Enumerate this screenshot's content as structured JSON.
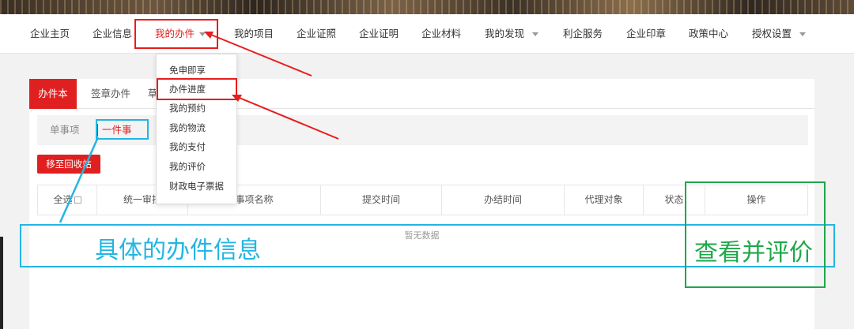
{
  "nav": {
    "items": [
      {
        "label": "企业主页"
      },
      {
        "label": "企业信息"
      },
      {
        "label": "我的办件"
      },
      {
        "label": "我的项目"
      },
      {
        "label": "企业证照"
      },
      {
        "label": "企业证明"
      },
      {
        "label": "企业材料"
      },
      {
        "label": "我的发现"
      },
      {
        "label": "利企服务"
      },
      {
        "label": "企业印章"
      },
      {
        "label": "政策中心"
      },
      {
        "label": "授权设置"
      }
    ]
  },
  "dropdown": {
    "items": [
      "免申即享",
      "办件进度",
      "我的预约",
      "我的物流",
      "我的支付",
      "我的评价",
      "财政电子票据"
    ]
  },
  "tabs": [
    "办件本",
    "签章办件",
    "草"
  ],
  "subtabs": [
    "单事项",
    "一件事"
  ],
  "recycle_button": "移至回收站",
  "table": {
    "select_all": "全选",
    "headers": [
      "统一审批",
      "事项名称",
      "提交时间",
      "办结时间",
      "代理对象",
      "状态",
      "操作"
    ],
    "empty_text": "暂无数据"
  },
  "annotations": {
    "detail_text": "具体的办件信息",
    "action_text": "查看并评价",
    "colors": {
      "red": "#e81c1c",
      "blue": "#23b5e3",
      "green": "#1fa84a"
    }
  }
}
